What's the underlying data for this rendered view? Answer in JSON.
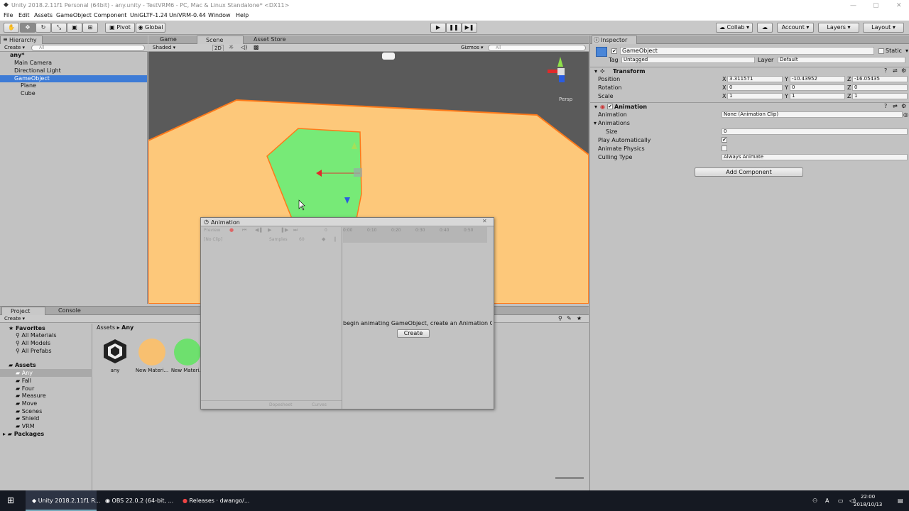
{
  "window": {
    "title": "Unity 2018.2.11f1 Personal (64bit) - any.unity - TestVRM6 - PC, Mac & Linux Standalone* <DX11>"
  },
  "menu": [
    "File",
    "Edit",
    "Assets",
    "GameObject",
    "Component",
    "UniGLTF-1.24",
    "UniVRM-0.44",
    "Window",
    "Help"
  ],
  "toolbar": {
    "pivot": "Pivot",
    "global": "Global",
    "collab": "Collab",
    "account": "Account",
    "layers": "Layers",
    "layout": "Layout"
  },
  "hierarchy": {
    "tab": "Hierarchy",
    "create": "Create",
    "search": "All",
    "scene": "any*",
    "items": [
      "Main Camera",
      "Directional Light",
      "GameObject",
      "Plane",
      "Cube"
    ]
  },
  "scene": {
    "tabs": [
      "Game",
      "Scene",
      "Asset Store"
    ],
    "shaded": "Shaded",
    "mode2d": "2D",
    "gizmos": "Gizmos",
    "search": "All",
    "persp": "Persp"
  },
  "inspector": {
    "tab": "Inspector",
    "object_name": "GameObject",
    "static": "Static",
    "tag_label": "Tag",
    "tag": "Untagged",
    "layer_label": "Layer",
    "layer": "Default",
    "transform": {
      "title": "Transform",
      "position_label": "Position",
      "rotation_label": "Rotation",
      "scale_label": "Scale",
      "position": [
        "3.311571",
        "-10.43952",
        "-16.05435"
      ],
      "rotation": [
        "0",
        "0",
        "0"
      ],
      "scale": [
        "1",
        "1",
        "1"
      ],
      "axes": [
        "X",
        "Y",
        "Z"
      ]
    },
    "animation": {
      "title": "Animation",
      "animation_label": "Animation",
      "animation_value": "None (Animation Clip)",
      "animations_label": "Animations",
      "size_label": "Size",
      "size_value": "0",
      "play_auto_label": "Play Automatically",
      "play_auto": true,
      "physics_label": "Animate Physics",
      "physics": false,
      "culling_label": "Culling Type",
      "culling_value": "Always Animate"
    },
    "add_component": "Add Component"
  },
  "animation_window": {
    "title": "Animation",
    "preview": "Preview",
    "clip": "[No Clip]",
    "samples_label": "Samples",
    "samples": "60",
    "ticks": [
      "0:00",
      "0:10",
      "0:20",
      "0:30",
      "0:40",
      "0:50"
    ],
    "frame": "0",
    "message": "begin animating GameObject, create an Animation C",
    "create": "Create",
    "dopesheet": "Dopesheet",
    "curves": "Curves"
  },
  "project": {
    "tabs": [
      "Project",
      "Console"
    ],
    "create": "Create",
    "favorites": "Favorites",
    "fav_items": [
      "All Materials",
      "All Models",
      "All Prefabs"
    ],
    "assets": "Assets",
    "asset_folders": [
      "Any",
      "Fall",
      "Four",
      "Measure",
      "Move",
      "Scenes",
      "Shield",
      "VRM"
    ],
    "packages": "Packages",
    "breadcrumb_root": "Assets",
    "breadcrumb_current": "Any",
    "files": [
      {
        "name": "any",
        "color": "#222222"
      },
      {
        "name": "New Materi...",
        "color": "#f8c070"
      },
      {
        "name": "New Materi...",
        "color": "#6ee06e"
      }
    ]
  },
  "taskbar": {
    "items": [
      "Unity 2018.2.11f1 R...",
      "OBS 22.0.2 (64-bit, ...",
      "Releases · dwango/..."
    ],
    "time": "22:00",
    "date": "2018/10/13",
    "lang": "A"
  },
  "colors": {
    "ground": "#fdc87a",
    "ground_edge": "#ff7a1a",
    "plane": "#77ea77",
    "selection": "#3d7bd6",
    "sky": "#5a5a5a"
  }
}
